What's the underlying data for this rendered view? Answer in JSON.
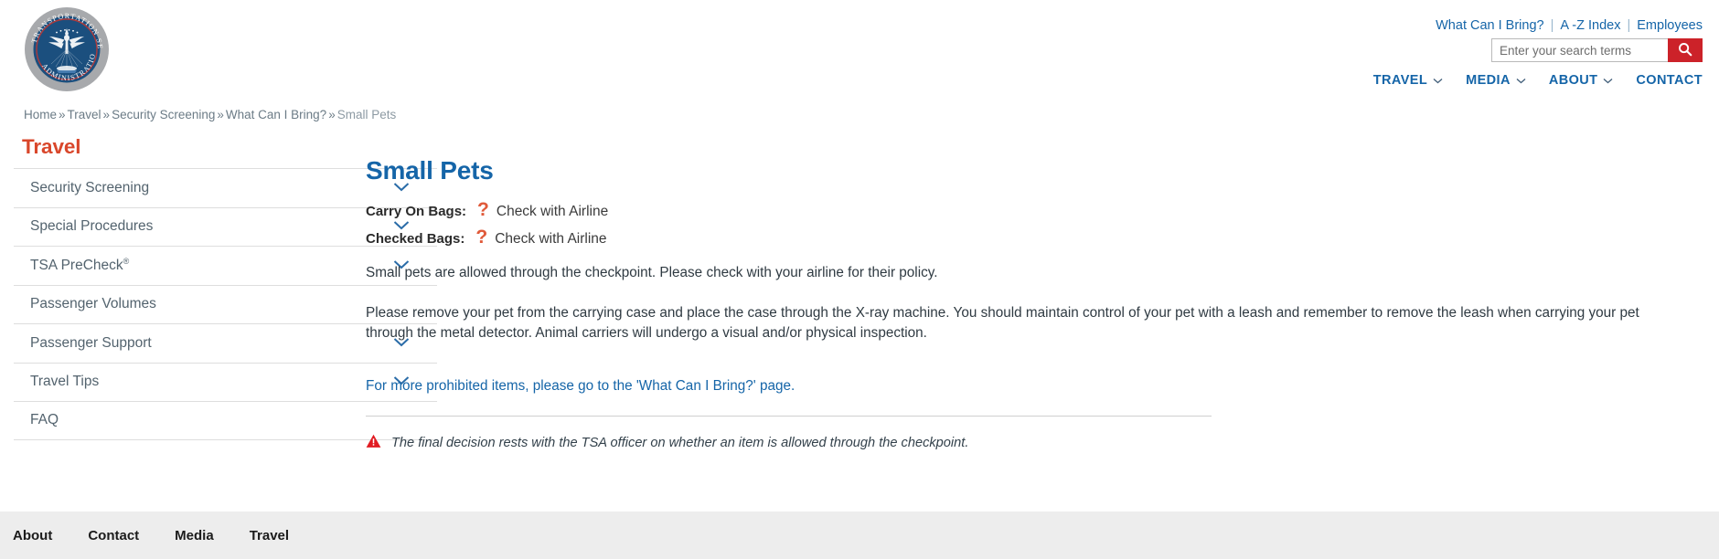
{
  "header": {
    "logo_alt": "Transportation Security Administration seal",
    "logo_text_top": "TRANSPORTATION SECURITY",
    "logo_text_bottom": "ADMINISTRATION",
    "utility_links": [
      {
        "label": "What Can I Bring?"
      },
      {
        "label": "A -Z Index"
      },
      {
        "label": "Employees"
      }
    ],
    "utility_separator": "|",
    "search": {
      "placeholder": "Enter your search terms",
      "value": "",
      "button_icon": "search-icon"
    },
    "nav": [
      {
        "label": "TRAVEL",
        "has_dropdown": true
      },
      {
        "label": "MEDIA",
        "has_dropdown": true
      },
      {
        "label": "ABOUT",
        "has_dropdown": true
      },
      {
        "label": "CONTACT",
        "has_dropdown": false
      }
    ]
  },
  "breadcrumb": {
    "separator": "»",
    "items": [
      {
        "label": "Home",
        "current": false
      },
      {
        "label": "Travel",
        "current": false
      },
      {
        "label": "Security Screening",
        "current": false
      },
      {
        "label": "What Can I Bring?",
        "current": false
      },
      {
        "label": "Small Pets",
        "current": true
      }
    ]
  },
  "sidebar": {
    "title": "Travel",
    "items": [
      {
        "label": "Security Screening",
        "expandable": true
      },
      {
        "label": "Special Procedures",
        "expandable": true
      },
      {
        "label": "TSA PreCheck",
        "superscript": "®",
        "expandable": true
      },
      {
        "label": "Passenger Volumes",
        "expandable": false
      },
      {
        "label": "Passenger Support",
        "expandable": true
      },
      {
        "label": "Travel Tips",
        "expandable": true
      },
      {
        "label": "FAQ",
        "expandable": false
      }
    ]
  },
  "content": {
    "title": "Small Pets",
    "bags": [
      {
        "label": "Carry On Bags:",
        "icon": "question-mark-icon",
        "value": "Check with Airline"
      },
      {
        "label": "Checked Bags:",
        "icon": "question-mark-icon",
        "value": "Check with Airline"
      }
    ],
    "paragraphs": [
      "Small pets are allowed through the checkpoint. Please check with your airline for their policy.",
      "Please remove your pet from the carrying case and place the case through the X-ray machine. You should maintain control of your pet with a leash and remember to remove the leash when carrying your pet through the metal detector. Animal carriers will undergo a visual and/or physical inspection."
    ],
    "more_link": "For more prohibited items, please go to the 'What Can I Bring?' page.",
    "notice": {
      "icon": "warning-triangle-icon",
      "text": "The final decision rests with the TSA officer on whether an item is allowed through the checkpoint."
    }
  },
  "footer": {
    "links": [
      {
        "label": "About"
      },
      {
        "label": "Contact"
      },
      {
        "label": "Media"
      },
      {
        "label": "Travel"
      }
    ]
  },
  "colors": {
    "brand_blue": "#1565a8",
    "brand_red": "#cc2229",
    "sidebar_title_red": "#d9472b",
    "question_orange": "#e05a3a",
    "warning_red": "#e11b22",
    "footer_bg": "#ededed",
    "text_gray": "#53636e"
  }
}
